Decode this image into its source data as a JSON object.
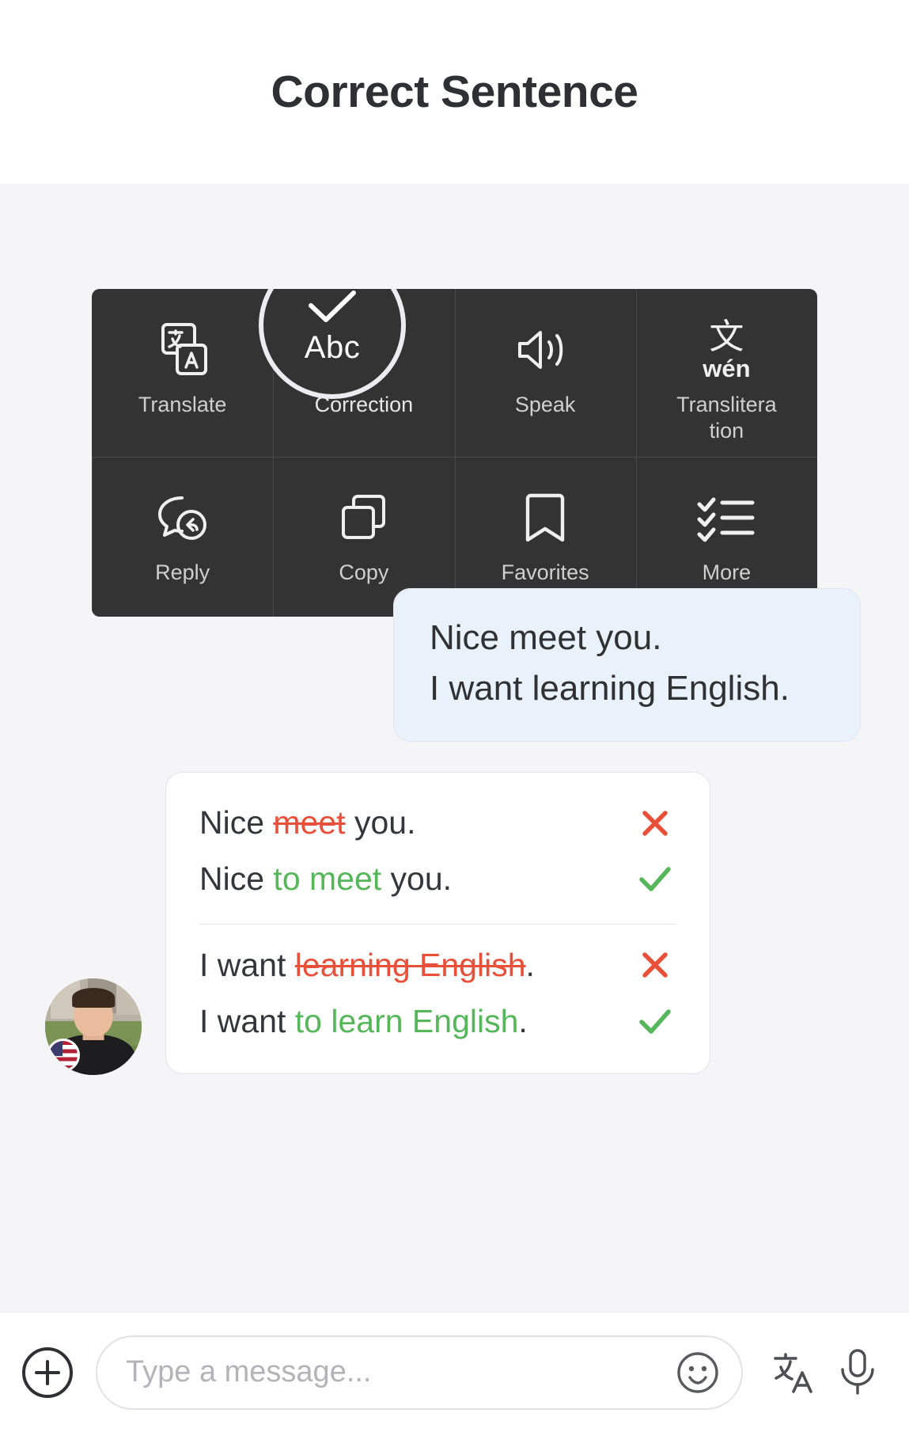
{
  "header": {
    "title": "Correct Sentence"
  },
  "context_menu": {
    "items": [
      {
        "label": "Translate",
        "icon": "translate-icon",
        "active": false
      },
      {
        "label": "Correction",
        "icon": "correction-abc-check-icon",
        "active": true
      },
      {
        "label": "Speak",
        "icon": "speaker-icon",
        "active": false
      },
      {
        "label": "Translitera\ntion",
        "icon": "transliteration-wen-icon",
        "active": false
      },
      {
        "label": "Reply",
        "icon": "reply-bubble-icon",
        "active": false
      },
      {
        "label": "Copy",
        "icon": "copy-icon",
        "active": false
      },
      {
        "label": "Favorites",
        "icon": "bookmark-icon",
        "active": false
      },
      {
        "label": "More",
        "icon": "checklist-icon",
        "active": false
      }
    ],
    "highlight": {
      "abc_text": "Abc",
      "icon": "check-icon"
    }
  },
  "message": {
    "lines": [
      "Nice meet you.",
      "I want learning English."
    ]
  },
  "correction": {
    "groups": [
      {
        "wrong": {
          "prefix": "Nice ",
          "strike": "meet",
          "suffix": " you.",
          "mark": "cross-icon"
        },
        "right": {
          "prefix": "Nice ",
          "fix": "to meet",
          "suffix": " you.",
          "mark": "check-icon"
        }
      },
      {
        "wrong": {
          "prefix": "I want ",
          "strike": "learning English",
          "suffix": ".",
          "mark": "cross-icon"
        },
        "right": {
          "prefix": "I want ",
          "fix": "to learn English",
          "suffix": ".",
          "mark": "check-icon"
        }
      }
    ]
  },
  "avatar": {
    "flag": "us-flag-badge"
  },
  "input_bar": {
    "add_label": "+",
    "placeholder": "Type a message...",
    "value": "",
    "emoji_icon": "smiley-icon",
    "translate_icon": "translate-icon",
    "mic_icon": "microphone-icon"
  },
  "colors": {
    "menu_bg": "#333333",
    "bubble_bg": "#e9f1fb",
    "error_red": "#e8503a",
    "correct_green": "#55b65a",
    "page_bg": "#f5f5f8",
    "text_dark": "#2f3133"
  }
}
